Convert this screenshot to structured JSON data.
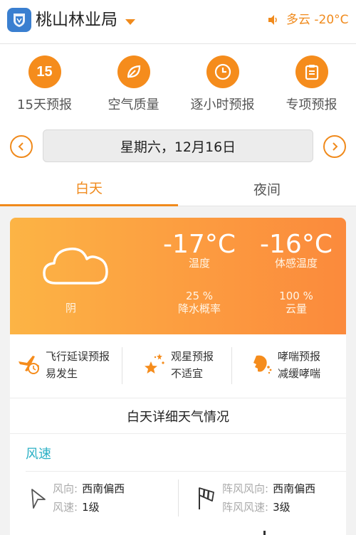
{
  "header": {
    "location": "桃山林业局",
    "weather": "多云 -20°C"
  },
  "quick_actions": [
    {
      "icon": "calendar-15-icon",
      "number": "15",
      "label": "15天预报"
    },
    {
      "icon": "leaf-icon",
      "label": "空气质量"
    },
    {
      "icon": "clock-icon",
      "label": "逐小时预报"
    },
    {
      "icon": "clipboard-icon",
      "label": "专项预报"
    }
  ],
  "date": "星期六，12月16日",
  "tabs": {
    "day": "白天",
    "night": "夜间"
  },
  "card": {
    "condition": "阴",
    "temp": "-17°C",
    "temp_label": "温度",
    "feels": "-16°C",
    "feels_label": "体感温度",
    "precip": "25 %",
    "precip_label": "降水概率",
    "cloud": "100 %",
    "cloud_label": "云量"
  },
  "indices": [
    {
      "icon": "plane-delay-icon",
      "title": "飞行延误预报",
      "value": "易发生"
    },
    {
      "icon": "stargazing-icon",
      "title": "观星预报",
      "value": "不适宜"
    },
    {
      "icon": "asthma-icon",
      "title": "哮喘预报",
      "value": "减缓哮喘"
    }
  ],
  "detail_title": "白天详细天气情况",
  "wind": {
    "heading": "风速",
    "dir_key": "风向:",
    "dir_val": "西南偏西",
    "speed_key": "风速:",
    "speed_val": "1级",
    "gust_dir_key": "阵风风向:",
    "gust_dir_val": "西南偏西",
    "gust_speed_key": "阵风风速:",
    "gust_speed_val": "3级"
  },
  "colors": {
    "accent": "#f08a1c",
    "wind_heading": "#2bb0c5"
  }
}
